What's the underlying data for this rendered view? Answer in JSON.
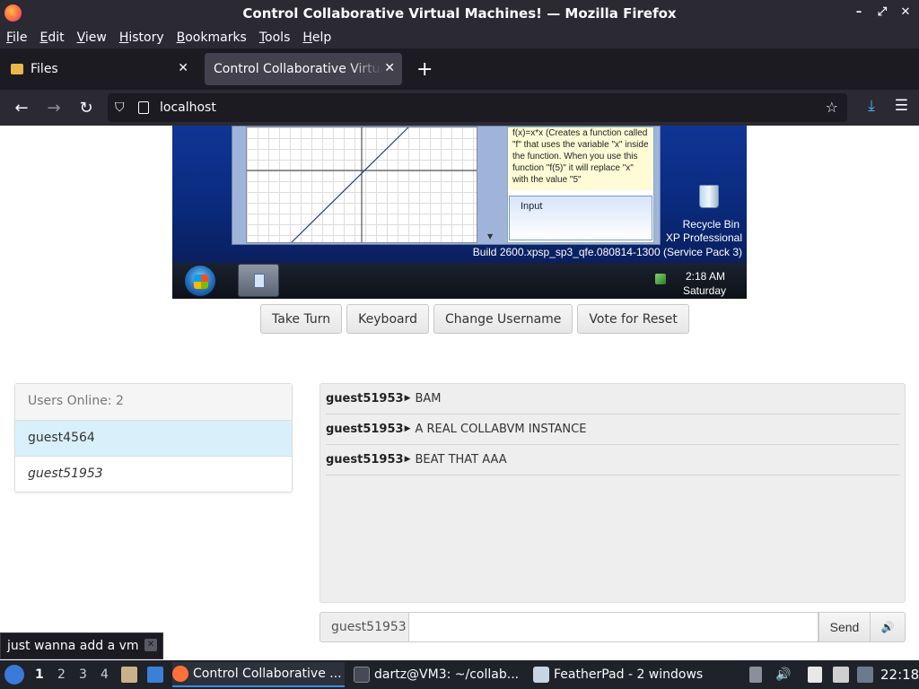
{
  "window": {
    "title": "Control Collaborative Virtual Machines! — Mozilla Firefox",
    "controls": [
      "–",
      "⤢",
      "✕"
    ]
  },
  "menu": [
    "File",
    "Edit",
    "View",
    "History",
    "Bookmarks",
    "Tools",
    "Help"
  ],
  "tabs": [
    {
      "label": "Files",
      "icon": "folder-icon",
      "active": false
    },
    {
      "label": "Control Collaborative Virtual Machines!",
      "icon": "",
      "active": true
    }
  ],
  "nav": {
    "url": "localhost",
    "back": "←",
    "forward": "→",
    "reload": "↻",
    "new_tab": "+",
    "close": "✕",
    "bookmark": "☆",
    "download": "⤓",
    "menu": "☰",
    "shield": "⛉"
  },
  "vm": {
    "help_text": "f(x)=x*x  (Creates a function called \"f\" that uses the variable \"x\" inside the function. When you use this function \"f(5)\" it will replace \"x\" with the value \"5\"",
    "input_label": "Input",
    "recycle_bin": "Recycle Bin",
    "xp_label": "XP Professional",
    "build": "Build 2600.xpsp_sp3_qfe.080814-1300 (Service Pack 3)",
    "time": "2:18 AM",
    "day": "Saturday",
    "scroll_down": "▼"
  },
  "vm_buttons": [
    "Take Turn",
    "Keyboard",
    "Change Username",
    "Vote for Reset"
  ],
  "users": {
    "header": "Users Online: 2",
    "list": [
      {
        "name": "guest4564",
        "style": "highlight"
      },
      {
        "name": "guest51953",
        "style": "italic"
      }
    ]
  },
  "chat": {
    "messages": [
      {
        "user": "guest51953",
        "text": "BAM"
      },
      {
        "user": "guest51953",
        "text": "A REAL COLLABVM INSTANCE"
      },
      {
        "user": "guest51953",
        "text": "BEAT THAT AAA"
      }
    ],
    "arrow": "▶",
    "username": "guest51953",
    "input_value": "",
    "send_label": "Send",
    "sound_icon": "🔊"
  },
  "notification": {
    "text": "just wanna add a vm",
    "close": "✕"
  },
  "taskbar": {
    "workspaces": [
      "1",
      "2",
      "3",
      "4"
    ],
    "tasks": [
      {
        "label": "Control Collaborative ...",
        "icon_color": "#ff7139",
        "active": true
      },
      {
        "label": "dartz@VM3: ~/collab...",
        "icon_color": "#444a56",
        "active": false
      },
      {
        "label": "FeatherPad - 2 windows",
        "icon_color": "#c9d4e3",
        "active": false
      }
    ],
    "clock": "22:18"
  }
}
